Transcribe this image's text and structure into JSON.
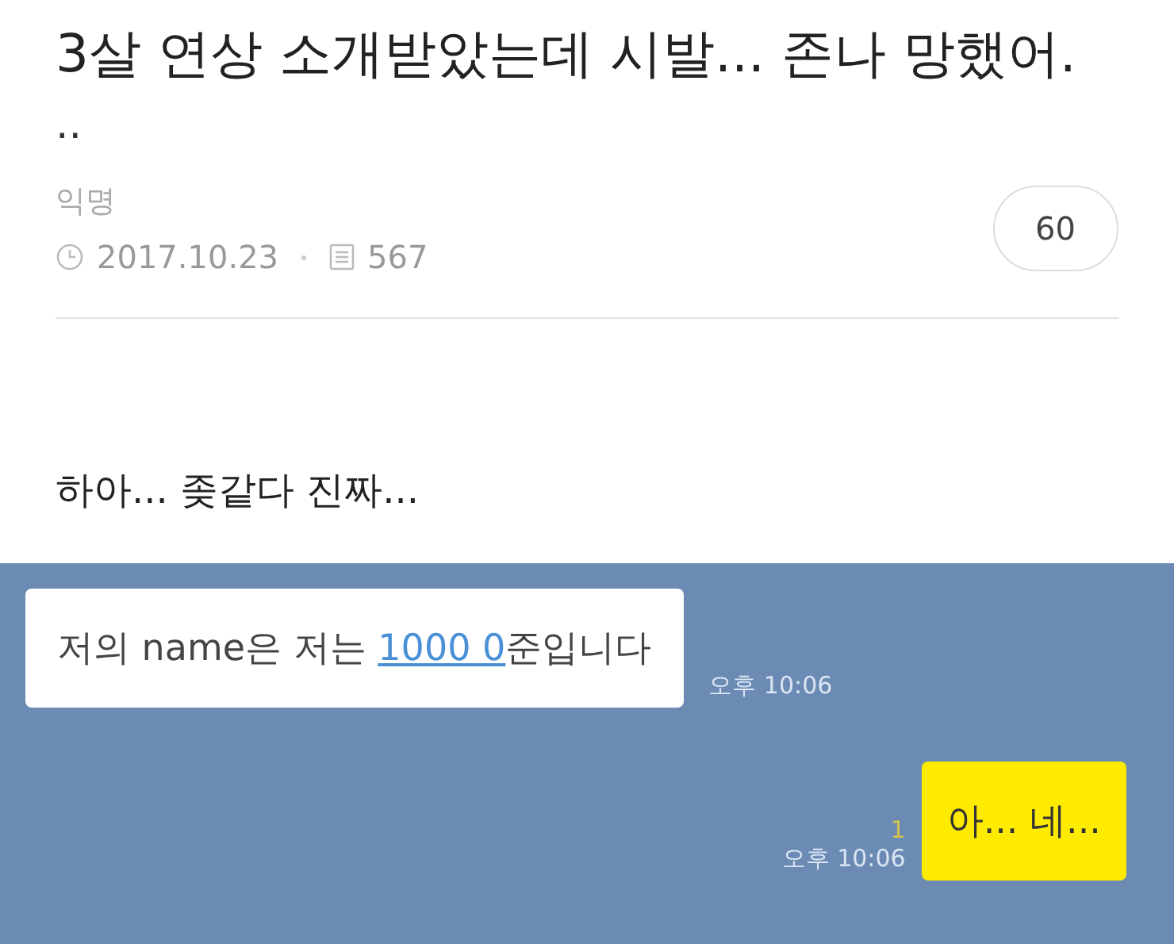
{
  "post": {
    "title": "3살 연상 소개받았는데 시발... 존나 망했어.",
    "title_tail": "..",
    "author": "익명",
    "date": "2017.10.23",
    "views": "567",
    "comment_count": "60",
    "body": "하아... 좆같다 진짜..."
  },
  "chat": {
    "messages": [
      {
        "kind": "received",
        "text_before": "저의 name은 저는 ",
        "link": "1000 0",
        "text_after": "준입니다",
        "time": "오후 10:06"
      },
      {
        "kind": "sent",
        "text": "아... 네...",
        "unread": "1",
        "time": "오후 10:06"
      }
    ]
  }
}
